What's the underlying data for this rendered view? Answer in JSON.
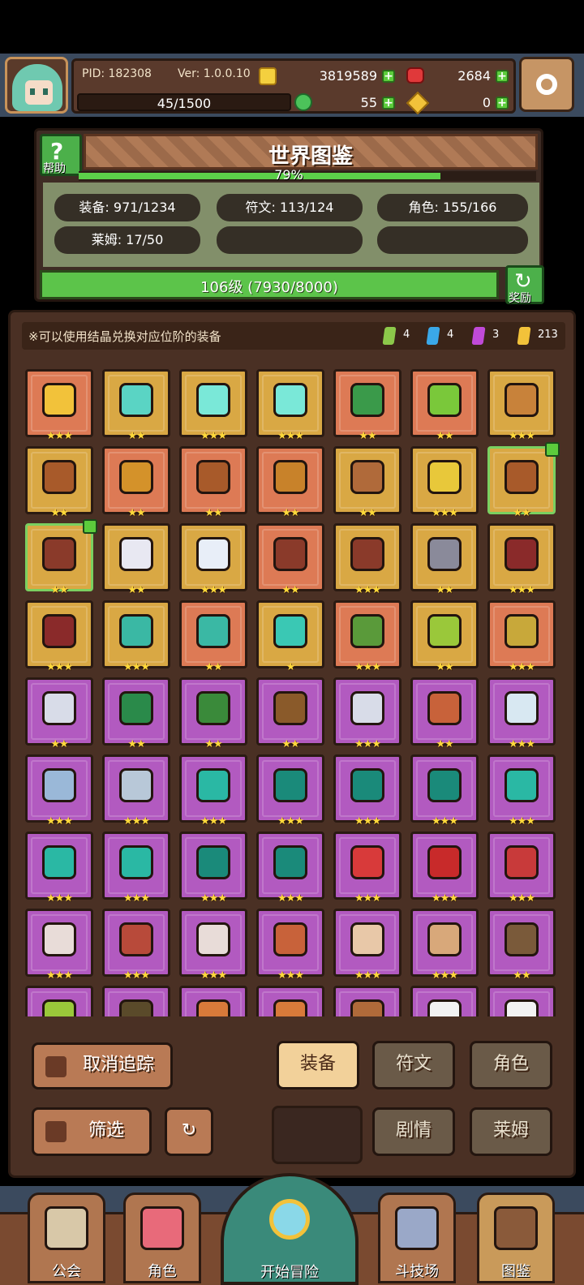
{
  "header": {
    "pid": "PID: 182308",
    "version": "Ver: 1.0.0.10",
    "gold": "3819589",
    "gems": "2684",
    "energy": "45/1500",
    "clover": "55",
    "keys": "0"
  },
  "codex": {
    "title": "世界图鉴",
    "help_label": "帮助",
    "progress_text": "79%",
    "progress": 0.79,
    "stats": {
      "equipment": "装备: 971/1234",
      "rune": "符文: 113/124",
      "role": "角色: 155/166",
      "slime": "莱姆: 17/50"
    },
    "level_text": "106级 (7930/8000)",
    "level_progress": 0.99,
    "reward_label": "奖励"
  },
  "notice": {
    "text": "※可以使用结晶兑换对应位阶的装备",
    "crystals": [
      {
        "color": "#8cc84a",
        "count": "4"
      },
      {
        "color": "#3aa8e8",
        "count": "4"
      },
      {
        "color": "#c04ad8",
        "count": "3"
      },
      {
        "color": "#f2c23a",
        "count": "213"
      }
    ]
  },
  "items": [
    {
      "bg": "red",
      "icon": "straw-hat-icon",
      "color": "#f2c23a",
      "stars": "★★★"
    },
    {
      "bg": "gold",
      "icon": "staff-icon",
      "color": "#5ad4c4",
      "stars": "★★"
    },
    {
      "bg": "gold",
      "icon": "orb-icon",
      "color": "#7ae8d8",
      "stars": "★★★"
    },
    {
      "bg": "gold",
      "icon": "gem-icon",
      "color": "#7ae8d8",
      "stars": "★★★"
    },
    {
      "bg": "red",
      "icon": "green-hood-icon",
      "color": "#3a9a4a",
      "stars": "★★"
    },
    {
      "bg": "red",
      "icon": "green-armor-icon",
      "color": "#7ac83a",
      "stars": "★★"
    },
    {
      "bg": "gold",
      "icon": "ring-icon",
      "color": "#c8823a",
      "stars": "★★★"
    },
    {
      "bg": "gold",
      "icon": "crossbow-icon",
      "color": "#a85a2a",
      "stars": "★★"
    },
    {
      "bg": "red",
      "icon": "wand-icon",
      "color": "#d4922a",
      "stars": "★★"
    },
    {
      "bg": "red",
      "icon": "necklace-icon",
      "color": "#a85a2a",
      "stars": "★★"
    },
    {
      "bg": "red",
      "icon": "spear-icon",
      "color": "#c8822a",
      "stars": "★★"
    },
    {
      "bg": "gold",
      "icon": "bronze-ring-icon",
      "color": "#b06a3a",
      "stars": "★★"
    },
    {
      "bg": "gold",
      "icon": "crystal-ring-icon",
      "color": "#e8c83a",
      "stars": "★★★"
    },
    {
      "bg": "gold",
      "icon": "axe-icon",
      "color": "#a85a2a",
      "stars": "★★",
      "tracked": true
    },
    {
      "bg": "gold",
      "icon": "diamond-ring-icon",
      "color": "#8a3a2a",
      "stars": "★★",
      "tracked": true
    },
    {
      "bg": "gold",
      "icon": "pearl-ring-icon",
      "color": "#e8e8f2",
      "stars": "★★"
    },
    {
      "bg": "gold",
      "icon": "pearl-icon",
      "color": "#e8eef8",
      "stars": "★★★"
    },
    {
      "bg": "red",
      "icon": "bracer-icon",
      "color": "#8a3a2a",
      "stars": "★★"
    },
    {
      "bg": "gold",
      "icon": "bone-necklace-icon",
      "color": "#8a3a2a",
      "stars": "★★★"
    },
    {
      "bg": "gold",
      "icon": "halberd-icon",
      "color": "#8a8a9a",
      "stars": "★★"
    },
    {
      "bg": "gold",
      "icon": "red-hood-icon",
      "color": "#8a2a2a",
      "stars": "★★★"
    },
    {
      "bg": "gold",
      "icon": "red-cloak-icon",
      "color": "#8a2a2a",
      "stars": "★★★"
    },
    {
      "bg": "gold",
      "icon": "bow-icon",
      "color": "#3ab8a4",
      "stars": "★★★"
    },
    {
      "bg": "red",
      "icon": "arrow-icon",
      "color": "#3ab8a4",
      "stars": "★★"
    },
    {
      "bg": "gold",
      "icon": "boots-icon",
      "color": "#3ac8b4",
      "stars": "★"
    },
    {
      "bg": "red",
      "icon": "leaf-helm-icon",
      "color": "#5a9a3a",
      "stars": "★★★"
    },
    {
      "bg": "gold",
      "icon": "bracelet-icon",
      "color": "#9ac83a",
      "stars": "★★"
    },
    {
      "bg": "red",
      "icon": "gold-crown-icon",
      "color": "#c8a83a",
      "stars": "★★★"
    },
    {
      "bg": "purple",
      "icon": "sword-icon",
      "color": "#d8dce8",
      "stars": "★★"
    },
    {
      "bg": "purple",
      "icon": "green-cap-icon",
      "color": "#2a8a4a",
      "stars": "★★"
    },
    {
      "bg": "purple",
      "icon": "green-tunic-icon",
      "color": "#3a8a3a",
      "stars": "★★"
    },
    {
      "bg": "purple",
      "icon": "longbow-icon",
      "color": "#8a5a2a",
      "stars": "★★"
    },
    {
      "bg": "purple",
      "icon": "lance-icon",
      "color": "#d8dce8",
      "stars": "★★★"
    },
    {
      "bg": "purple",
      "icon": "gloves-icon",
      "color": "#c8623a",
      "stars": "★★"
    },
    {
      "bg": "purple",
      "icon": "silver-armor-icon",
      "color": "#d8e8f2",
      "stars": "★★★"
    },
    {
      "bg": "purple",
      "icon": "silver-ring-icon",
      "color": "#9ab8d8",
      "stars": "★★★"
    },
    {
      "bg": "purple",
      "icon": "silver-boots-icon",
      "color": "#b8c8d8",
      "stars": "★★★"
    },
    {
      "bg": "purple",
      "icon": "scepter-icon",
      "color": "#2ab8a4",
      "stars": "★★★"
    },
    {
      "bg": "purple",
      "icon": "witch-hat-icon",
      "color": "#1a8a7a",
      "stars": "★★★"
    },
    {
      "bg": "purple",
      "icon": "jade-armor-icon",
      "color": "#1a8a7a",
      "stars": "★★★"
    },
    {
      "bg": "purple",
      "icon": "jade-bracer-icon",
      "color": "#1a8a7a",
      "stars": "★★★"
    },
    {
      "bg": "purple",
      "icon": "jade-ring-icon",
      "color": "#2ab8a4",
      "stars": "★★★"
    },
    {
      "bg": "purple",
      "icon": "jade-boots-icon",
      "color": "#2ab8a4",
      "stars": "★★★"
    },
    {
      "bg": "purple",
      "icon": "jade-gem-icon",
      "color": "#2ab8a4",
      "stars": "★★★"
    },
    {
      "bg": "purple",
      "icon": "jade-necklace-icon",
      "color": "#1a8a7a",
      "stars": "★★★"
    },
    {
      "bg": "purple",
      "icon": "jade-band-icon",
      "color": "#1a8a7a",
      "stars": "★★★"
    },
    {
      "bg": "purple",
      "icon": "demon-mask-icon",
      "color": "#d83a3a",
      "stars": "★★★"
    },
    {
      "bg": "purple",
      "icon": "red-robe-icon",
      "color": "#c82a2a",
      "stars": "★★★"
    },
    {
      "bg": "purple",
      "icon": "red-boots-icon",
      "color": "#c83a3a",
      "stars": "★★★"
    },
    {
      "bg": "purple",
      "icon": "wing-armor-icon",
      "color": "#e8dcd8",
      "stars": "★★★"
    },
    {
      "bg": "purple",
      "icon": "wing-cape-icon",
      "color": "#b84a3a",
      "stars": "★★★"
    },
    {
      "bg": "purple",
      "icon": "wing-necklace-icon",
      "color": "#e8dcd8",
      "stars": "★★★"
    },
    {
      "bg": "purple",
      "icon": "fire-staff-icon",
      "color": "#c8623a",
      "stars": "★★★"
    },
    {
      "bg": "purple",
      "icon": "horned-helm-icon",
      "color": "#e8c8a8",
      "stars": "★★★"
    },
    {
      "bg": "purple",
      "icon": "winged-vest-icon",
      "color": "#d8a87a",
      "stars": "★★★"
    },
    {
      "bg": "purple",
      "icon": "heavy-crossbow-icon",
      "color": "#7a5a3a",
      "stars": "★★"
    },
    {
      "bg": "purple",
      "icon": "dagger-icon",
      "color": "#9ac83a",
      "stars": ""
    },
    {
      "bg": "purple",
      "icon": "dark-ring-icon",
      "color": "#5a4a2a",
      "stars": ""
    },
    {
      "bg": "purple",
      "icon": "cat-hat-icon",
      "color": "#d87a3a",
      "stars": ""
    },
    {
      "bg": "purple",
      "icon": "copper-hat-icon",
      "color": "#d87a3a",
      "stars": ""
    },
    {
      "bg": "purple",
      "icon": "copper-ring-icon",
      "color": "#b06a3a",
      "stars": ""
    },
    {
      "bg": "purple",
      "icon": "white-orb-icon",
      "color": "#f2f2f2",
      "stars": ""
    },
    {
      "bg": "purple",
      "icon": "white-cloud-icon",
      "color": "#f2f2f2",
      "stars": ""
    }
  ],
  "buttons": {
    "untrack": "取消追踪",
    "filter": "筛选",
    "equipment": "装备",
    "rune": "符文",
    "role": "角色",
    "story": "剧情",
    "slime": "莱姆"
  },
  "nav": {
    "guild": "公会",
    "role": "角色",
    "adventure": "开始冒险",
    "arena": "斗技场",
    "codex": "图鉴"
  }
}
